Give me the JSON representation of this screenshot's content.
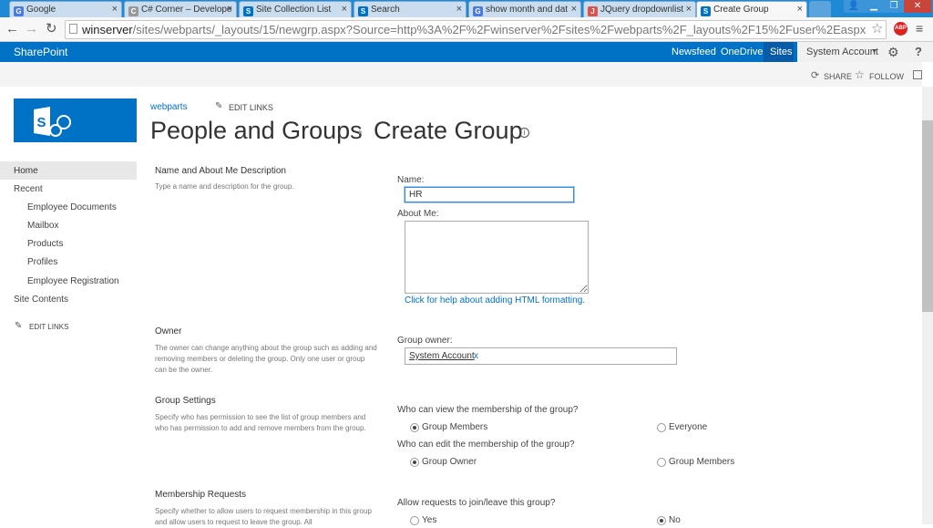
{
  "browser": {
    "tabs": [
      {
        "label": "Google",
        "fav": "G",
        "color": "#4a7be4"
      },
      {
        "label": "C# Corner – Develope",
        "fav": "C",
        "color": "#999999"
      },
      {
        "label": "Site Collection List",
        "fav": "S",
        "color": "#0072c6"
      },
      {
        "label": "Search",
        "fav": "S",
        "color": "#0072c6"
      },
      {
        "label": "show month and dat",
        "fav": "G",
        "color": "#4a7be4"
      },
      {
        "label": "JQuery dropdownlist",
        "fav": "J",
        "color": "#d9534f"
      },
      {
        "label": "Create Group",
        "fav": "S",
        "color": "#0072c6"
      }
    ],
    "url_host": "winserver",
    "url_path": "/sites/webparts/_layouts/15/newgrp.aspx?Source=http%3A%2F%2Fwinserver%2Fsites%2Fwebparts%2F_layouts%2F15%2Fuser%2Easpx",
    "abp": "ABP"
  },
  "suite": {
    "brand": "SharePoint",
    "links": [
      "Newsfeed",
      "OneDrive",
      "Sites"
    ],
    "account": "System Account",
    "gear": "⚙",
    "help": "?"
  },
  "ribbon": {
    "share": "SHARE",
    "follow": "FOLLOW"
  },
  "header": {
    "site_link": "webparts",
    "edit_links": "EDIT LINKS",
    "title_part1": "People and Groups",
    "title_part2": "Create Group",
    "info": "i"
  },
  "nav": {
    "home": "Home",
    "recent": "Recent",
    "items": [
      "Employee Documents",
      "Mailbox",
      "Products",
      "Profiles",
      "Employee Registration"
    ],
    "site_contents": "Site Contents",
    "edit_links": "EDIT LINKS"
  },
  "form": {
    "name_section": {
      "title": "Name and About Me Description",
      "desc": "Type a name and description for the group."
    },
    "name_label": "Name:",
    "name_value": "HR",
    "about_label": "About Me:",
    "html_help": "Click for help about adding HTML formatting.",
    "owner_section": {
      "title": "Owner",
      "desc": "The owner can change anything about the group such as adding and removing members or deleting the group. Only one user or group can be the owner."
    },
    "owner_label": "Group owner:",
    "owner_value": "System Account",
    "owner_remove": "x",
    "settings_section": {
      "title": "Group Settings",
      "desc": "Specify who has permission to see the list of group members and who has permission to add and remove members from the group."
    },
    "view_q": "Who can view the membership of the group?",
    "view_opt1": "Group Members",
    "view_opt2": "Everyone",
    "edit_q": "Who can edit the membership of the group?",
    "edit_opt1": "Group Owner",
    "edit_opt2": "Group Members",
    "membership_section": {
      "title": "Membership Requests",
      "desc": "Specify whether to allow users to request membership in this group and allow users to request to leave the group. All"
    },
    "join_q": "Allow requests to join/leave this group?",
    "join_opt1": "Yes",
    "join_opt2": "No"
  }
}
